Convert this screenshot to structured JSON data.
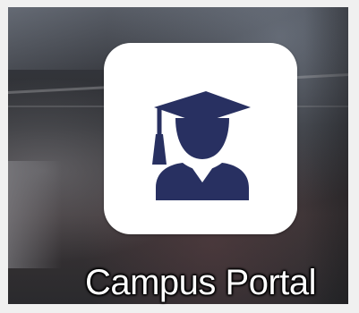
{
  "desktop": {
    "icon": {
      "label": "Campus Portal",
      "icon_name": "graduate-icon",
      "tile_color": "#ffffff",
      "glyph_color": "#283061"
    }
  }
}
